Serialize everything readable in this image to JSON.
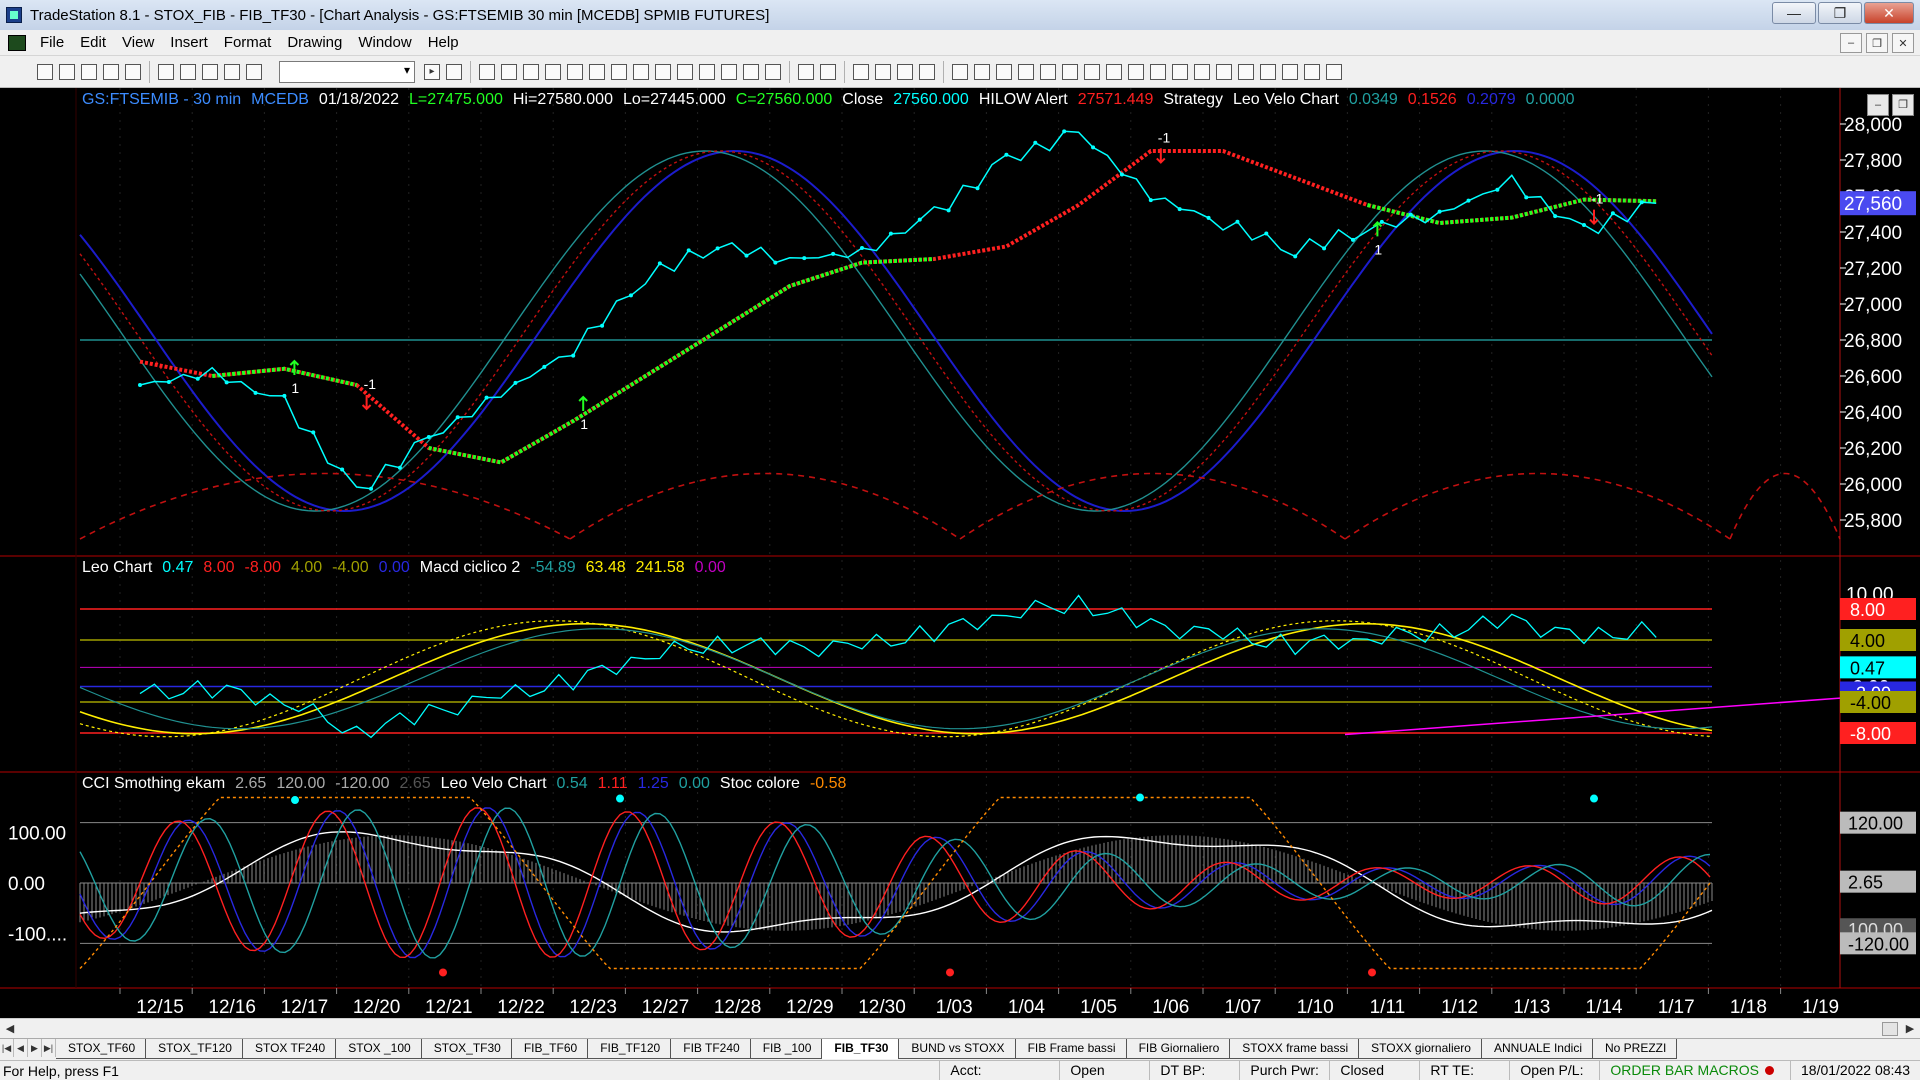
{
  "window": {
    "title": "TradeStation 8.1 - STOX_FIB - FIB_TF30 - [Chart Analysis - GS:FTSEMIB  30 min  [MCEDB] SPMIB FUTURES]",
    "min": "—",
    "max": "❐",
    "close": "✕"
  },
  "menu": [
    "File",
    "Edit",
    "View",
    "Insert",
    "Format",
    "Drawing",
    "Window",
    "Help"
  ],
  "mdi": [
    "–",
    "❐",
    "✕"
  ],
  "colors": {
    "price": "#00ffff",
    "red_line": "#ff2020",
    "green_line": "#22ff22",
    "blue": "#1c1ccc",
    "teal": "#208a8a",
    "yellow": "#ffee00",
    "magenta": "#ff00ff"
  },
  "legend1": {
    "symbol": "GS:FTSEMIB - 30 min",
    "exchange": "MCEDB",
    "date": "01/18/2022",
    "low_open": "L=27475.000",
    "hi": "Hi=27580.000",
    "lo": "Lo=27445.000",
    "close_eq": "C=27560.000",
    "close_label": "Close",
    "close_value": "27560.000",
    "hilow": "HILOW Alert",
    "hilow_value": "27571.449",
    "strategy": "Strategy",
    "leo_velo": "Leo Velo Chart",
    "v1": "0.0349",
    "v2": "0.1526",
    "v3": "0.2079",
    "v4": "0.0000"
  },
  "legend2": {
    "leo_chart": "Leo Chart",
    "v1": "0.47",
    "v2": "8.00",
    "v3": "-8.00",
    "v4": "4.00",
    "v5": "-4.00",
    "v6": "0.00",
    "macd": "Macd ciclico 2",
    "m1": "-54.89",
    "m2": "63.48",
    "m3": "241.58",
    "m4": "0.00"
  },
  "legend3": {
    "cci": "CCI Smothing ekam",
    "c1": "2.65",
    "c2": "120.00",
    "c3": "-120.00",
    "c4": "2.65",
    "leo_velo": "Leo Velo Chart",
    "l1": "0.54",
    "l2": "1.11",
    "l3": "1.25",
    "l4": "0.00",
    "stoc": "Stoc colore",
    "s1": "-0.58"
  },
  "price_axis": [
    "28,000",
    "27,800",
    "27,600",
    "27,400",
    "27,200",
    "27,000",
    "26,800",
    "26,600",
    "26,400",
    "26,200",
    "26,000",
    "25,800"
  ],
  "price_badge": "27,560",
  "ind2_axis": [
    "10.00",
    "4.00",
    "-2.00",
    "-8.00"
  ],
  "ind2_badges": [
    "8.00",
    "4.00",
    "0.47",
    "-2.00",
    "-4.00",
    "-8.00"
  ],
  "ind3_axis": [
    "100.00",
    "0.00",
    "-100...."
  ],
  "ind3_badges": [
    "120.00",
    "2.65",
    "100.00",
    "-120.00"
  ],
  "dates": [
    "12/15",
    "12/16",
    "12/17",
    "12/20",
    "12/21",
    "12/22",
    "12/23",
    "12/27",
    "12/28",
    "12/29",
    "12/30",
    "1/03",
    "1/04",
    "1/05",
    "1/06",
    "1/07",
    "1/10",
    "1/11",
    "1/12",
    "1/13",
    "1/14",
    "1/17",
    "1/18",
    "1/19"
  ],
  "signals": [
    {
      "label": "1",
      "dir": "up"
    },
    {
      "label": "-1",
      "dir": "down"
    },
    {
      "label": "1",
      "dir": "up"
    },
    {
      "label": "-1",
      "dir": "down"
    },
    {
      "label": "1",
      "dir": "up"
    },
    {
      "label": "-1",
      "dir": "down"
    }
  ],
  "chart_data": {
    "type": "line",
    "x": [
      "12/15",
      "12/16",
      "12/17",
      "12/20",
      "12/21",
      "12/22",
      "12/23",
      "12/27",
      "12/28",
      "12/29",
      "12/30",
      "1/03",
      "1/04",
      "1/05",
      "1/06",
      "1/07",
      "1/10",
      "1/11",
      "1/12",
      "1/13",
      "1/14",
      "1/17"
    ],
    "series": [
      {
        "values": [
          26550,
          26620,
          26450,
          25950,
          26250,
          26500,
          26750,
          27150,
          27330,
          27250,
          27280,
          27500,
          27800,
          27950,
          27600,
          27450,
          27300,
          27420,
          27500,
          27680,
          27400,
          27560
        ]
      },
      {
        "name": "HILOW Alert",
        "values": [
          26680,
          26600,
          26640,
          26550,
          26200,
          26120,
          26350,
          26600,
          26850,
          27100,
          27230,
          27250,
          27320,
          27550,
          27850,
          27850,
          27700,
          27550,
          27450,
          27480,
          27580,
          27571
        ]
      }
    ],
    "ylim": [
      25700,
      28100
    ]
  },
  "tabs": [
    "STOX_TF60",
    "STOX_TF120",
    "STOX TF240",
    "STOX _100",
    "STOX_TF30",
    "FIB_TF60",
    "FIB_TF120",
    "FIB TF240",
    "FIB _100",
    "FIB_TF30",
    "BUND vs STOXX",
    "FIB Frame bassi",
    "FIB Giornaliero",
    "STOXX frame bassi",
    "STOXX giornaliero",
    "ANNUALE Indici",
    "No PREZZI"
  ],
  "active_tab": 9,
  "status": {
    "help": "For Help, press F1",
    "cells": [
      "Acct:",
      "Open Psns:",
      "DT BP:",
      "Purch Pwr:",
      "Closed P/L:",
      "RT TE:",
      "Open P/L:"
    ],
    "macros": "ORDER BAR  MACROS",
    "datetime": "18/01/2022 08:43"
  }
}
